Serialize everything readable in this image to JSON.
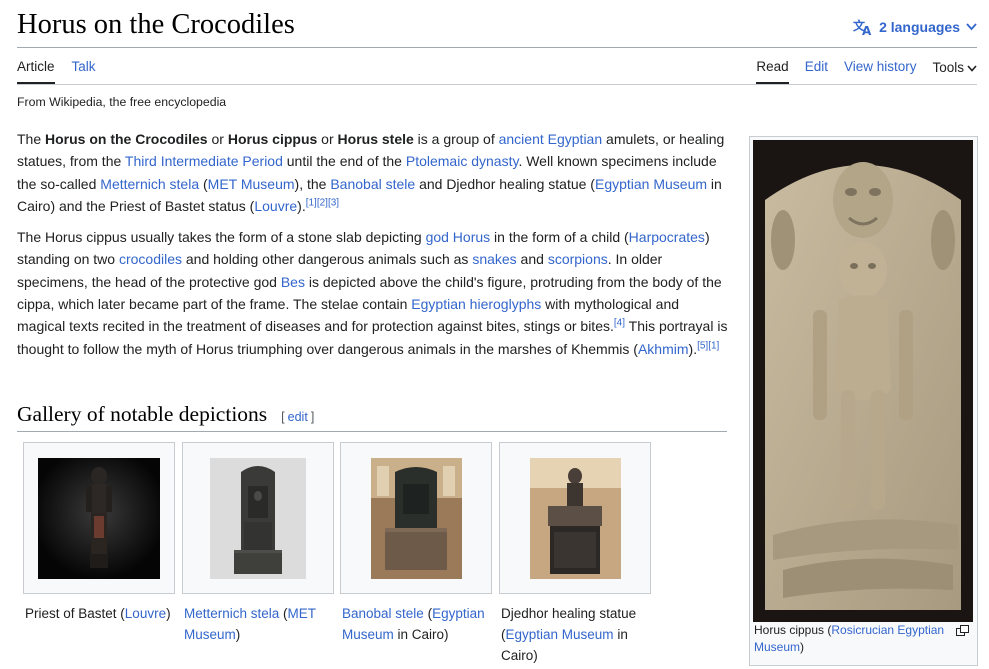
{
  "page": {
    "title": "Horus on the Crocodiles",
    "languages_label": "2 languages",
    "tagline": "From Wikipedia, the free encyclopedia"
  },
  "tabs": {
    "left": [
      "Article",
      "Talk"
    ],
    "right": [
      "Read",
      "Edit",
      "View history",
      "Tools"
    ]
  },
  "paragraph1": {
    "t1": "The ",
    "b1": "Horus on the Crocodiles",
    "t2": " or ",
    "b2": "Horus cippus",
    "t3": " or ",
    "b3": "Horus stele",
    "t4": " is a group of ",
    "l1": "ancient Egyptian",
    "t5": " amulets, or healing statues, from the ",
    "l2": "Third Intermediate Period",
    "t6": " until the end of the ",
    "l3": "Ptolemaic dynasty",
    "t7": ". Well known specimens include the so-called ",
    "l4": "Metternich stela",
    "t8": " (",
    "l5": "MET Museum",
    "t9": "), the ",
    "l6": "Banobal stele",
    "t10": " and Djedhor healing statue (",
    "l7": "Egyptian Museum",
    "t11": " in Cairo) and the Priest of Bastet status (",
    "l8": "Louvre",
    "t12": ").",
    "refs": "[1][2][3]"
  },
  "paragraph2": {
    "t1": "The Horus cippus usually takes the form of a stone slab depicting ",
    "l1": "god Horus",
    "t2": " in the form of a child (",
    "l2": "Harpocrates",
    "t3": ") standing on two ",
    "l3": "crocodiles",
    "t4": " and holding other dangerous animals such as ",
    "l4": "snakes",
    "t5": " and ",
    "l5": "scorpions",
    "t6": ". In older specimens, the head of the protective god ",
    "l6": "Bes",
    "t7": " is depicted above the child's figure, protruding from the body of the cippa, which later became part of the frame. The stelae contain ",
    "l7": "Egyptian hieroglyphs",
    "t8": " with mythological and magical texts recited in the treatment of diseases and for protection against bites, stings or bites.",
    "r1": "[4]",
    "t9": " This portrayal is thought to follow the myth of Horus triumphing over dangerous animals in the marshes of Khemmis (",
    "l8": "Akhmim",
    "t10": ").",
    "r2": "[5][1]"
  },
  "section": {
    "heading": "Gallery of notable depictions",
    "edit_open": "[",
    "edit_label": "edit",
    "edit_close": "]"
  },
  "gallery": [
    {
      "pre": "Priest of Bastet (",
      "link": "Louvre",
      "post": ")"
    },
    {
      "pre": "",
      "link": "Metternich stela",
      "mid": " (",
      "link2": "MET Museum",
      "post": ")"
    },
    {
      "pre": "",
      "link": "Banobal stele",
      "mid": " (",
      "link2": "Egyptian Museum",
      "post": " in Cairo)"
    },
    {
      "pre": "Djedhor healing statue (",
      "link": "Egyptian Museum",
      "post": " in Cairo)"
    }
  ],
  "figure": {
    "caption_pre": "Horus cippus (",
    "caption_link": "Rosicrucian Egyptian Museum",
    "caption_post": ")"
  },
  "colors": {
    "link": "#3366cc",
    "text": "#202122",
    "border": "#c8ccd1"
  },
  "icons": [
    "translate-icon",
    "chevron-down-icon",
    "magnify-icon"
  ]
}
